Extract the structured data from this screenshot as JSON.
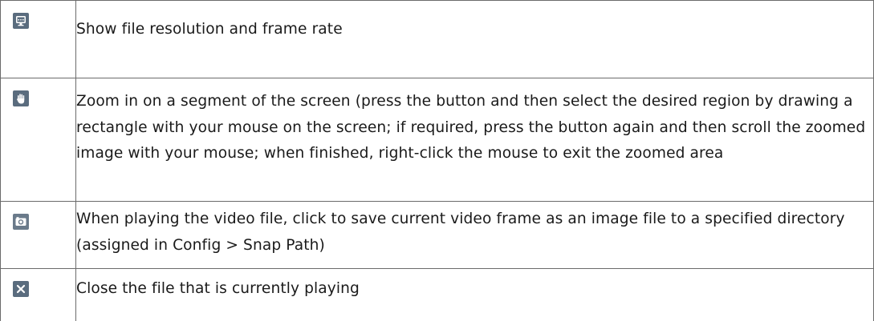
{
  "rows": [
    {
      "icon": "monitor-info-icon",
      "description": "Show file resolution and frame rate"
    },
    {
      "icon": "hand-zoom-icon",
      "description": "Zoom in on a segment of the screen (press the button and then select the desired region by drawing a rectangle with your mouse on the screen; if required, press the button again and then scroll the zoomed image with your mouse; when finished, right-click the mouse to exit the zoomed area"
    },
    {
      "icon": "camera-snapshot-icon",
      "description": "When playing the video file, click to save current video frame as an image file to a specified directory (assigned in Config > Snap Path)"
    },
    {
      "icon": "close-file-icon",
      "description": "Close the file that is currently playing"
    }
  ],
  "colors": {
    "icon_bg": "#5a6c7e",
    "icon_fg": "#ffffff",
    "border": "#6b6b6b",
    "text": "#1a1a1a"
  }
}
